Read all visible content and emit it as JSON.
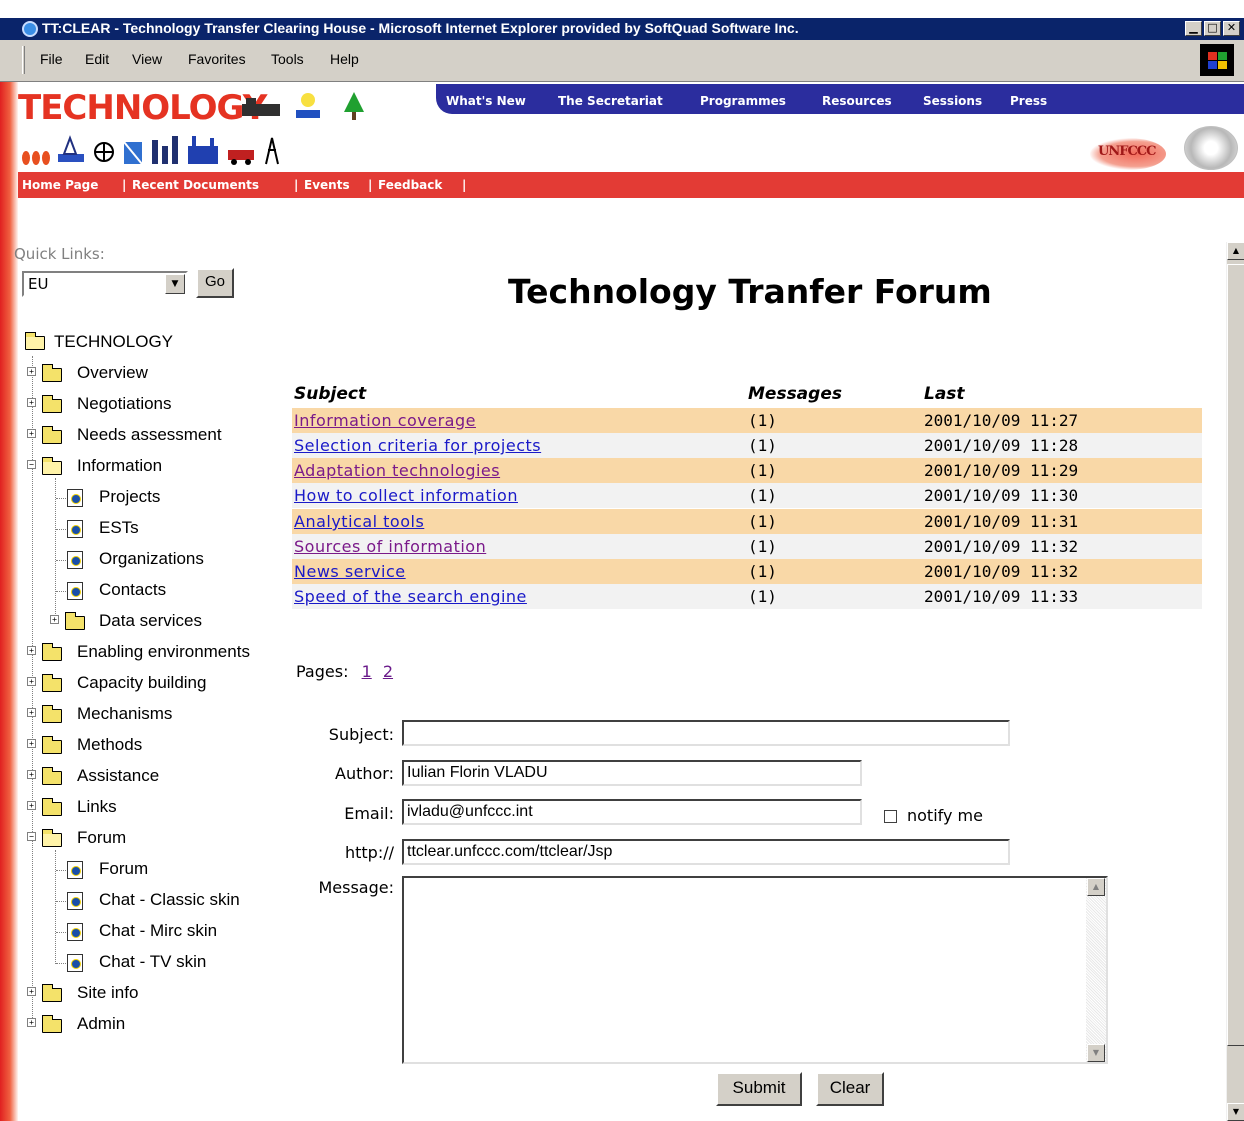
{
  "window": {
    "title": "TT:CLEAR - Technology Transfer Clearing House - Microsoft Internet Explorer provided by SoftQuad Software Inc.",
    "minimize": "▁",
    "maximize": "□",
    "close": "✕"
  },
  "menu": [
    "File",
    "Edit",
    "View",
    "Favorites",
    "Tools",
    "Help"
  ],
  "header": {
    "logo_text": "TECHNOLOGY",
    "unfccc_text": "UNFCCC",
    "top_nav": [
      "What's New",
      "The Secretariat",
      "Programmes",
      "Resources",
      "Sessions",
      "Press"
    ]
  },
  "subnav": [
    "Home Page",
    "Recent Documents",
    "Events",
    "Feedback"
  ],
  "separators": [
    "|",
    "|",
    "|",
    "|"
  ],
  "quick_links": {
    "label": "Quick Links:",
    "selected": "EU",
    "go": "Go"
  },
  "tree": {
    "root": "TECHNOLOGY",
    "items": [
      "Overview",
      "Negotiations",
      "Needs assessment",
      "Information",
      "Projects",
      "ESTs",
      "Organizations",
      "Contacts",
      "Data services",
      "Enabling environments",
      "Capacity building",
      "Mechanisms",
      "Methods",
      "Assistance",
      "Links",
      "Forum",
      "Forum",
      "Chat - Classic skin",
      "Chat - Mirc skin",
      "Chat - TV skin",
      "Site info",
      "Admin"
    ]
  },
  "page_title": "Technology Tranfer Forum",
  "forum": {
    "headers": [
      "Subject",
      "Messages",
      "Last"
    ],
    "rows": [
      {
        "subject": "Information coverage",
        "messages": "(1)",
        "last": "2001/10/09 11:27"
      },
      {
        "subject": "Selection criteria for projects",
        "messages": "(1)",
        "last": "2001/10/09 11:28"
      },
      {
        "subject": "Adaptation technologies",
        "messages": "(1)",
        "last": "2001/10/09 11:29"
      },
      {
        "subject": "How to collect information",
        "messages": "(1)",
        "last": "2001/10/09 11:30"
      },
      {
        "subject": "Analytical tools",
        "messages": "(1)",
        "last": "2001/10/09 11:31"
      },
      {
        "subject": "Sources of information",
        "messages": "(1)",
        "last": "2001/10/09 11:32"
      },
      {
        "subject": "News service",
        "messages": "(1)",
        "last": "2001/10/09 11:32"
      },
      {
        "subject": "Speed of the search engine",
        "messages": "(1)",
        "last": "2001/10/09 11:33"
      }
    ]
  },
  "pages": {
    "label": "Pages:",
    "links": [
      "1",
      "2"
    ]
  },
  "form": {
    "subject_label": "Subject:",
    "subject_value": "",
    "author_label": "Author:",
    "author_value": "Iulian Florin VLADU",
    "email_label": "Email:",
    "email_value": "ivladu@unfccc.int",
    "notify_label": "notify me",
    "url_label": "http://",
    "url_value": "ttclear.unfccc.com/ttclear/Jsp",
    "message_label": "Message:",
    "message_value": "",
    "submit": "Submit",
    "clear": "Clear"
  },
  "colors": {
    "title_bar": "#0a246a",
    "top_nav": "#2b2d9e",
    "red_bar": "#e33b35",
    "row_odd": "#f9d8a7",
    "row_even": "#f2f2f2",
    "link_blue": "#1a1ac8",
    "link_visited": "#7a1a8a"
  }
}
